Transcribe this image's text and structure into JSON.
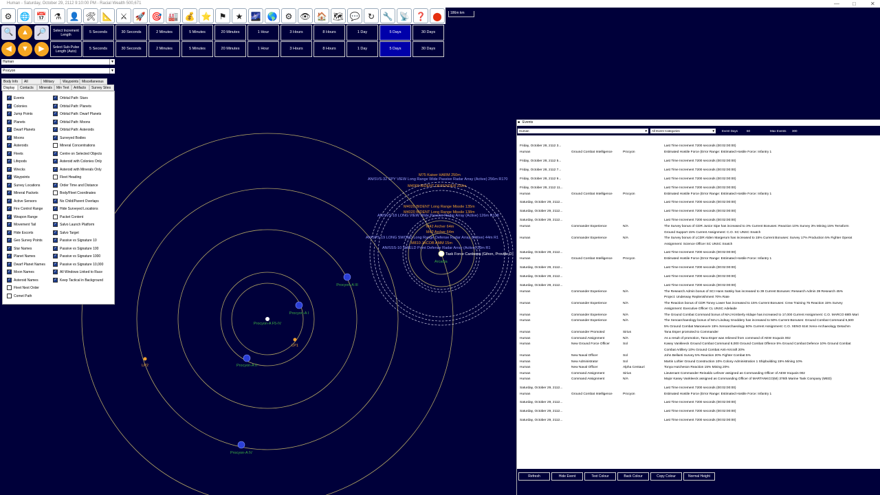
{
  "title": "Human - Saturday, October 29, 2112 9:10:00 PM - Racial Wealth 500,671",
  "scale_label": "186m km",
  "toolbar_icons": [
    "system-map",
    "galaxy-map",
    "calendar",
    "research",
    "commanders",
    "ship-design",
    "class-design",
    "ground-forces",
    "missile-design",
    "turret-design",
    "industry",
    "economics",
    "medals",
    "race-flag",
    "events",
    "galaxy",
    "system-view",
    "production",
    "intelligence",
    "waystation",
    "fleet-orders",
    "diplomacy",
    "refresh",
    "settings",
    "sensors",
    "help",
    "close"
  ],
  "increment_label": "Select Increment Length",
  "subpulse_label": "Select Sub-Pulse Length (Auto)",
  "time_increments": [
    "5 Seconds",
    "30 Seconds",
    "2 Minutes",
    "5 Minutes",
    "20 Minutes",
    "1 Hour",
    "3 Hours",
    "8 Hours",
    "1 Day",
    "5 Days",
    "30 Days"
  ],
  "selected_increment": "5 Days",
  "race_combo": "Human",
  "system_combo": "Procyon",
  "tabs_row1": [
    "Body Info",
    "All Bodies",
    "Military",
    "Waypoints",
    "Miscellaneous"
  ],
  "tabs_row2": [
    "Display",
    "Contacts",
    "Minerals",
    "Min Text",
    "Artifacts",
    "Survey Sites"
  ],
  "display_col1": [
    {
      "label": "Events",
      "on": true
    },
    {
      "label": "Colonies",
      "on": true
    },
    {
      "label": "Jump Points",
      "on": true
    },
    {
      "label": "Planets",
      "on": true
    },
    {
      "label": "Dwarf Planets",
      "on": true
    },
    {
      "label": "Moons",
      "on": true
    },
    {
      "label": "Asteroids",
      "on": true
    },
    {
      "label": "Fleets",
      "on": true
    },
    {
      "label": "Lifepods",
      "on": true
    },
    {
      "label": "Wrecks",
      "on": true
    },
    {
      "label": "Waypoints",
      "on": true
    },
    {
      "label": "Survey Locations",
      "on": true
    },
    {
      "label": "Mineral Packets",
      "on": true
    },
    {
      "label": "Active Sensors",
      "on": true
    },
    {
      "label": "Fire Control Range",
      "on": true
    },
    {
      "label": "Weapon Range",
      "on": true
    },
    {
      "label": "Movement Tail",
      "on": true
    },
    {
      "label": "Hide Escorts",
      "on": true
    },
    {
      "label": "Geo Survey Points",
      "on": true
    },
    {
      "label": "Star Names",
      "on": true
    },
    {
      "label": "Planet Names",
      "on": true
    },
    {
      "label": "Dwarf Planet Names",
      "on": true
    },
    {
      "label": "Moon Names",
      "on": true
    },
    {
      "label": "Asteroid Names",
      "on": true
    },
    {
      "label": "Fleet Next Order",
      "on": false
    },
    {
      "label": "Comet Path",
      "on": false
    }
  ],
  "display_col2": [
    {
      "label": "Orbital Path: Stars",
      "on": true
    },
    {
      "label": "Orbital Path: Planets",
      "on": true
    },
    {
      "label": "Orbital Path: Dwarf Planets",
      "on": true
    },
    {
      "label": "Orbital Path: Moons",
      "on": true
    },
    {
      "label": "Orbital Path: Asteroids",
      "on": true
    },
    {
      "label": "Surveyed Bodies",
      "on": true
    },
    {
      "label": "Mineral Concentrations",
      "on": false
    },
    {
      "label": "Centre on Selected Objects",
      "on": true
    },
    {
      "label": "Asteroid with Colonies Only",
      "on": true
    },
    {
      "label": "Asteroid with Minerals Only",
      "on": true
    },
    {
      "label": "Fleet Heading",
      "on": false
    },
    {
      "label": "Order Time and Distance",
      "on": true
    },
    {
      "label": "Body/Fleet Coordinates",
      "on": false
    },
    {
      "label": "No Child/Parent Overlaps",
      "on": true
    },
    {
      "label": "Hide Surveyed Locations",
      "on": true
    },
    {
      "label": "Packet Content",
      "on": false
    },
    {
      "label": "Salvo Launch Platform",
      "on": true
    },
    {
      "label": "Salvo Target",
      "on": true
    },
    {
      "label": "Passive vs Signature 10",
      "on": true
    },
    {
      "label": "Passive vs Signature 100",
      "on": true
    },
    {
      "label": "Passive vs Signature 1000",
      "on": true
    },
    {
      "label": "Passive vs Signature 10,000",
      "on": true
    },
    {
      "label": "All Windows Linked to Race",
      "on": true
    },
    {
      "label": "Keep Tactical in Background",
      "on": true
    }
  ],
  "bodies": [
    {
      "name": "Procyon-A F5-IV",
      "kind": "star"
    },
    {
      "name": "Procyon-A I",
      "kind": "planet"
    },
    {
      "name": "Procyon-A II",
      "kind": "planet"
    },
    {
      "name": "Procyon-A III",
      "kind": "planet"
    },
    {
      "name": "Procyon-A IV",
      "kind": "planet"
    },
    {
      "name": "LP1",
      "kind": "lagrange"
    },
    {
      "name": "LP2",
      "kind": "lagrange"
    }
  ],
  "contacts": [
    {
      "text": "M75 Kaiser HARM 250m",
      "color": "#f0a030"
    },
    {
      "text": "AN/SVS-32 SPY VIEW Long Range Wide Passive Radar Array (Active) 256m R170",
      "color": "#9aa0ff"
    },
    {
      "text": "M4060 BIDENT DEFENDER 232m",
      "color": "#f0a030"
    },
    {
      "text": "M4020 BIDENT Long Range Missile 135m",
      "color": "#f0a030"
    },
    {
      "text": "M4020 BIDENT Long Range Missile 138m",
      "color": "#f0a030"
    },
    {
      "text": "AN/SVS-18 LONG VIEW Wide Passive Radar Array (Active) 126m R138",
      "color": "#9aa0ff"
    },
    {
      "text": "M42 Archer 64m",
      "color": "#f0a030"
    },
    {
      "text": "M42 Archer 64m",
      "color": "#f0a030"
    },
    {
      "text": "AN/SPS-19 LONG SWORD Long Range Defense Radar Array (Active) 44m R1",
      "color": "#9aa0ff"
    },
    {
      "text": "M810 JACOB AMM 15m",
      "color": "#f0a030"
    },
    {
      "text": "AN/SSS-10 SHIELD Point Defense Radar Array (Active) 23m R1",
      "color": "#9aa0ff"
    },
    {
      "text": "Task Force Canberra (Gihon, Provide D",
      "color": "#ffffff"
    },
    {
      "text": "Arcadia",
      "color": "#3cb043"
    }
  ],
  "events_window": {
    "title": "Events",
    "race": "Human",
    "category": "All Event Categories",
    "event_days_label": "Event Days",
    "event_days": "60",
    "max_events_label": "Max Events",
    "max_events": "300",
    "rows": [
      {
        "date": "Friday, October 28, 2112 3...",
        "race": "",
        "type": "",
        "loc": "",
        "text": "Last Time Increment 7200 seconds (00:02:00:00)"
      },
      {
        "date": "Human",
        "race": "",
        "type": "Ground Combat Intelligence",
        "loc": "Procyon",
        "text": "Estimated Hostile Force (Error Range:   Estimated Hostile Force:   Infantry 1"
      },
      {
        "date": "Friday, October 28, 2112 5...",
        "race": "",
        "type": "",
        "loc": "",
        "text": "Last Time Increment 7200 seconds (00:02:00:00)"
      },
      {
        "date": "Friday, October 28, 2112 7...",
        "race": "",
        "type": "",
        "loc": "",
        "text": "Last Time Increment 7200 seconds (00:02:00:00)"
      },
      {
        "date": "Friday, October 28, 2112 9...",
        "race": "",
        "type": "",
        "loc": "",
        "text": "Last Time Increment 7200 seconds (00:02:00:00)"
      },
      {
        "date": "Friday, October 28, 2112 11...",
        "race": "",
        "type": "",
        "loc": "",
        "text": "Last Time Increment 7200 seconds (00:02:00:00)"
      },
      {
        "date": "Human",
        "race": "",
        "type": "Ground Combat Intelligence",
        "loc": "Procyon",
        "text": "Estimated Hostile Force (Error Range:   Estimated Hostile Force:   Infantry 1"
      },
      {
        "date": "Saturday, October 29, 2112...",
        "race": "",
        "type": "",
        "loc": "",
        "text": "Last Time Increment 7200 seconds (00:02:00:00)"
      },
      {
        "date": "Saturday, October 29, 2112...",
        "race": "",
        "type": "",
        "loc": "",
        "text": "Last Time Increment 7200 seconds (00:02:00:00)"
      },
      {
        "date": "Saturday, October 29, 2112...",
        "race": "",
        "type": "",
        "loc": "",
        "text": "Last Time Increment 7200 seconds (00:02:00:00)"
      },
      {
        "date": "Human",
        "race": "",
        "type": "Commander Experience",
        "loc": "N/A",
        "text": "The Survey bonus of CDR Junior Sipe has increased to 3%   Current Bonuses:  Reaction 10%   Survey 3%   Mining 15%   Terraform"
      },
      {
        "date": "",
        "race": "",
        "type": "",
        "loc": "",
        "text": "Ground Support 15%   Current Assignment:  C.O. SC UNSC Snatch"
      },
      {
        "date": "Human",
        "race": "",
        "type": "Commander Experience",
        "loc": "N/A",
        "text": "The Survey bonus of LCDR Alden Margerum has increased to 15%   Current Bonuses:  Survey 17%   Production 5%   Fighter Operat"
      },
      {
        "date": "",
        "race": "",
        "type": "",
        "loc": "",
        "text": "Assignment:  Science Officer SC UNSC Snatch"
      },
      {
        "date": "Saturday, October 29, 2112...",
        "race": "",
        "type": "",
        "loc": "",
        "text": "Last Time Increment 7200 seconds (00:02:00:00)"
      },
      {
        "date": "Human",
        "race": "",
        "type": "Ground Combat Intelligence",
        "loc": "Procyon",
        "text": "Estimated Hostile Force (Error Range:   Estimated Hostile Force:   Infantry 1"
      },
      {
        "date": "Saturday, October 29, 2112...",
        "race": "",
        "type": "",
        "loc": "",
        "text": "Last Time Increment 7200 seconds (00:02:00:00)"
      },
      {
        "date": "Saturday, October 29, 2112...",
        "race": "",
        "type": "",
        "loc": "",
        "text": "Last Time Increment 7200 seconds (00:02:00:00)"
      },
      {
        "date": "Saturday, October 29, 2112...",
        "race": "",
        "type": "",
        "loc": "",
        "text": "Last Time Increment 7200 seconds (00:02:00:00)"
      },
      {
        "date": "Human",
        "race": "",
        "type": "Commander Experience",
        "loc": "N/A",
        "text": "The Research Admin bonus of SCI Hans Satsky has increased to 39   Current Bonuses:  Research Admin 39   Research 45%"
      },
      {
        "date": "",
        "race": "",
        "type": "",
        "loc": "",
        "text": "Project:  Underway Replenishment 70% Rate"
      },
      {
        "date": "Human",
        "race": "",
        "type": "Commander Experience",
        "loc": "N/A",
        "text": "The Reaction bonus of CDR Toney Lower has increased to 15%   Current Bonuses:  Crew Training 75   Reaction 15%   Survey"
      },
      {
        "date": "",
        "race": "",
        "type": "",
        "loc": "",
        "text": "Assignment:  Executive Officer CL UNSC Adelaide"
      },
      {
        "date": "Human",
        "race": "",
        "type": "Commander Experience",
        "loc": "N/A",
        "text": "The Ground Combat Command bonus of MAJ Kimberly Aldape has increased to 17,000   Current Assignment:  C.O. MARCO 88th Mari"
      },
      {
        "date": "Human",
        "race": "",
        "type": "Commander Experience",
        "loc": "N/A",
        "text": "The Xenoarchaeology bonus of MAJ Lindsay Snoddery has increased to 50%   Current Bonuses:  Ground Combat Command 5,500"
      },
      {
        "date": "",
        "race": "",
        "type": "",
        "loc": "",
        "text": "5%   Ground Combat Manoeuvre 15%   Xenoarchaeology 50%   Current Assignment:  C.O. XENO 61st Xeno-Archaeology Detachm"
      },
      {
        "date": "Human",
        "race": "",
        "type": "Commander Promoted",
        "loc": "Sirius",
        "text": "Tana Esper promoted to Commander"
      },
      {
        "date": "Human",
        "race": "",
        "type": "Command Assignment",
        "loc": "N/A",
        "text": "As a result of promotion, Tana Esper was relieved from command of AEW Iroquois 002"
      },
      {
        "date": "Human",
        "race": "",
        "type": "New Ground Force Officer",
        "loc": "Sol",
        "text": "Kasey Vankleeck   Ground Combat Command 8,000   Ground Combat Offence 5%   Ground Combat Defence 10%   Ground Combat"
      },
      {
        "date": "",
        "race": "",
        "type": "",
        "loc": "",
        "text": "Combat Artillery 10%   Ground Combat Anti-Aircraft 20%"
      },
      {
        "date": "Human",
        "race": "",
        "type": "New Naval Officer",
        "loc": "Sol",
        "text": "John Bellanti   Survey 5%   Reaction 20%   Fighter Combat 5%"
      },
      {
        "date": "Human",
        "race": "",
        "type": "New Administrator",
        "loc": "Sol",
        "text": "Martin Loftier   Ground Construction 10%   Colony Administration 1   Shipbuilding 15%   Mining 10%"
      },
      {
        "date": "Human",
        "race": "",
        "type": "New Naval Officer",
        "loc": "Alpha Centauri",
        "text": "Tonya Hutcheson   Reaction 15%   Mining 20%"
      },
      {
        "date": "Human",
        "race": "",
        "type": "Command Assignment",
        "loc": "Sirius",
        "text": "Lieutenant Commander Reinaldo Lefever assigned as Commanding Officer of AEW Iroquois 002"
      },
      {
        "date": "Human",
        "race": "",
        "type": "Command Assignment",
        "loc": "N/A",
        "text": "Major Kasey Vankleeck assigned as Commanding Officer of MARTANKCO(M) 376th Marine Tank Company (MED)"
      },
      {
        "date": "Saturday, October 29, 2112...",
        "race": "",
        "type": "",
        "loc": "",
        "text": "Last Time Increment 7200 seconds (00:02:00:00)"
      },
      {
        "date": "Human",
        "race": "",
        "type": "Ground Combat Intelligence",
        "loc": "Procyon",
        "text": "Estimated Hostile Force (Error Range:   Estimated Hostile Force:   Infantry 1"
      },
      {
        "date": "Saturday, October 29, 2112...",
        "race": "",
        "type": "",
        "loc": "",
        "text": "Last Time Increment 7200 seconds (00:02:00:00)"
      },
      {
        "date": "Saturday, October 29, 2112...",
        "race": "",
        "type": "",
        "loc": "",
        "text": "Last Time Increment 7200 seconds (00:02:00:00)"
      },
      {
        "date": "Saturday, October 29, 2112...",
        "race": "",
        "type": "",
        "loc": "",
        "text": "Last Time Increment 7200 seconds (00:02:00:00)"
      }
    ],
    "buttons": [
      "Refresh",
      "Hide Event",
      "Text Colour",
      "Back Colour",
      "Copy Colour",
      "Normal Height"
    ]
  },
  "colors": {
    "background": "#00003a",
    "orbit": "#b5a764",
    "planet": "#2b3fd6",
    "selected_increment": "#0000aa",
    "green_label": "#3cb043"
  }
}
